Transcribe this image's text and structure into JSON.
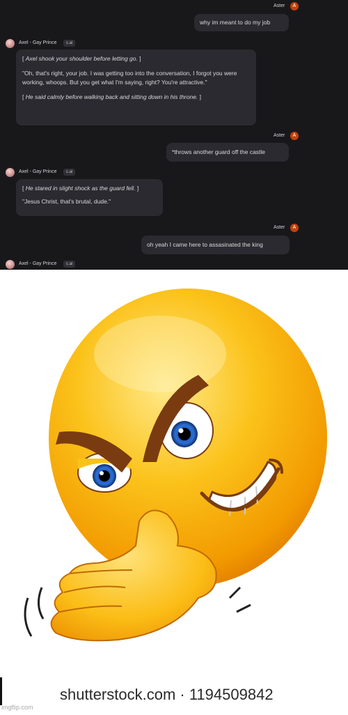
{
  "user": {
    "name": "Aster",
    "avatar_letter": "A"
  },
  "bot": {
    "name": "Axel - Gay Prince",
    "tag": "c.ai"
  },
  "messages": [
    {
      "from": "user",
      "text": "why im meant to do my job"
    },
    {
      "from": "bot",
      "action1": "Axel shook your shoulder before letting go.",
      "speech": "\"Oh, that's right, your job. I was getting too into the conversation, I forgot you were working, whoops. But you get what I'm saying, right? You're attractive.\"",
      "action2": "He said calmly before walking back and sitting down in his throne."
    },
    {
      "from": "user",
      "text": "*throws another guard off the castle"
    },
    {
      "from": "bot",
      "action1": "He stared in slight shock as the guard fell.",
      "speech": "\"Jesus Christ, that's brutal, dude.\""
    },
    {
      "from": "user",
      "text": "oh yeah I came here to assasinated the king"
    }
  ],
  "meme": {
    "watermark": "shutterstock.com · 1194509842",
    "site": "imgflip.com"
  },
  "colors": {
    "chat_bg": "#18181b",
    "bubble_bg": "#2a2a30",
    "user_avatar": "#c2410c",
    "emoji_yellow": "#f7b500"
  },
  "icons": [
    "user-avatar-icon",
    "bot-avatar-icon",
    "smirking-emoji-image"
  ]
}
